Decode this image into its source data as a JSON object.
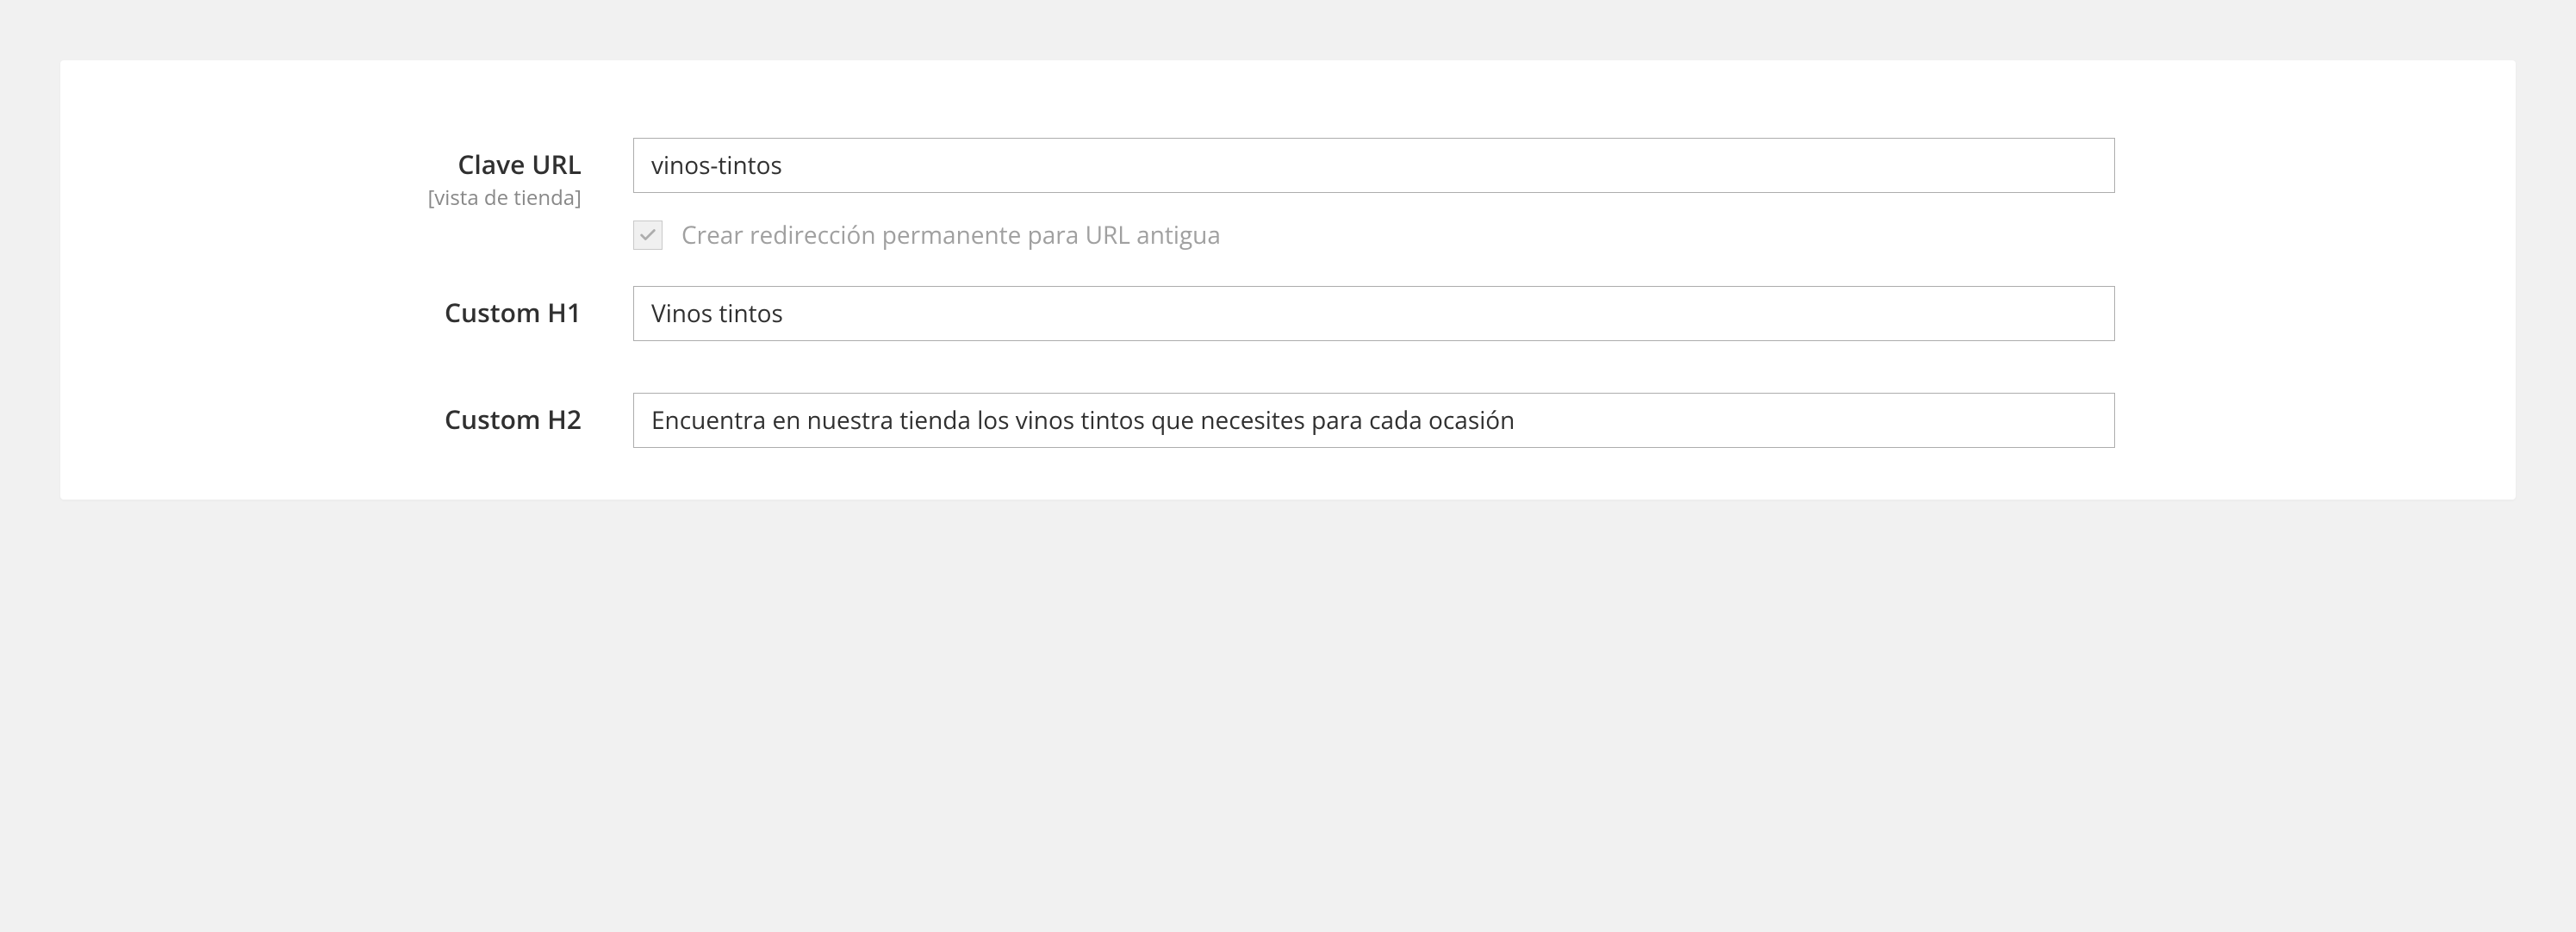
{
  "fields": {
    "url_key": {
      "label": "Clave URL",
      "scope": "[vista de tienda]",
      "value": "vinos-tintos",
      "redirect": {
        "checked": true,
        "label": "Crear redirección permanente para URL antigua"
      }
    },
    "custom_h1": {
      "label": "Custom H1",
      "value": "Vinos tintos"
    },
    "custom_h2": {
      "label": "Custom H2",
      "value": "Encuentra en nuestra tienda los vinos tintos que necesites para cada ocasión"
    }
  }
}
